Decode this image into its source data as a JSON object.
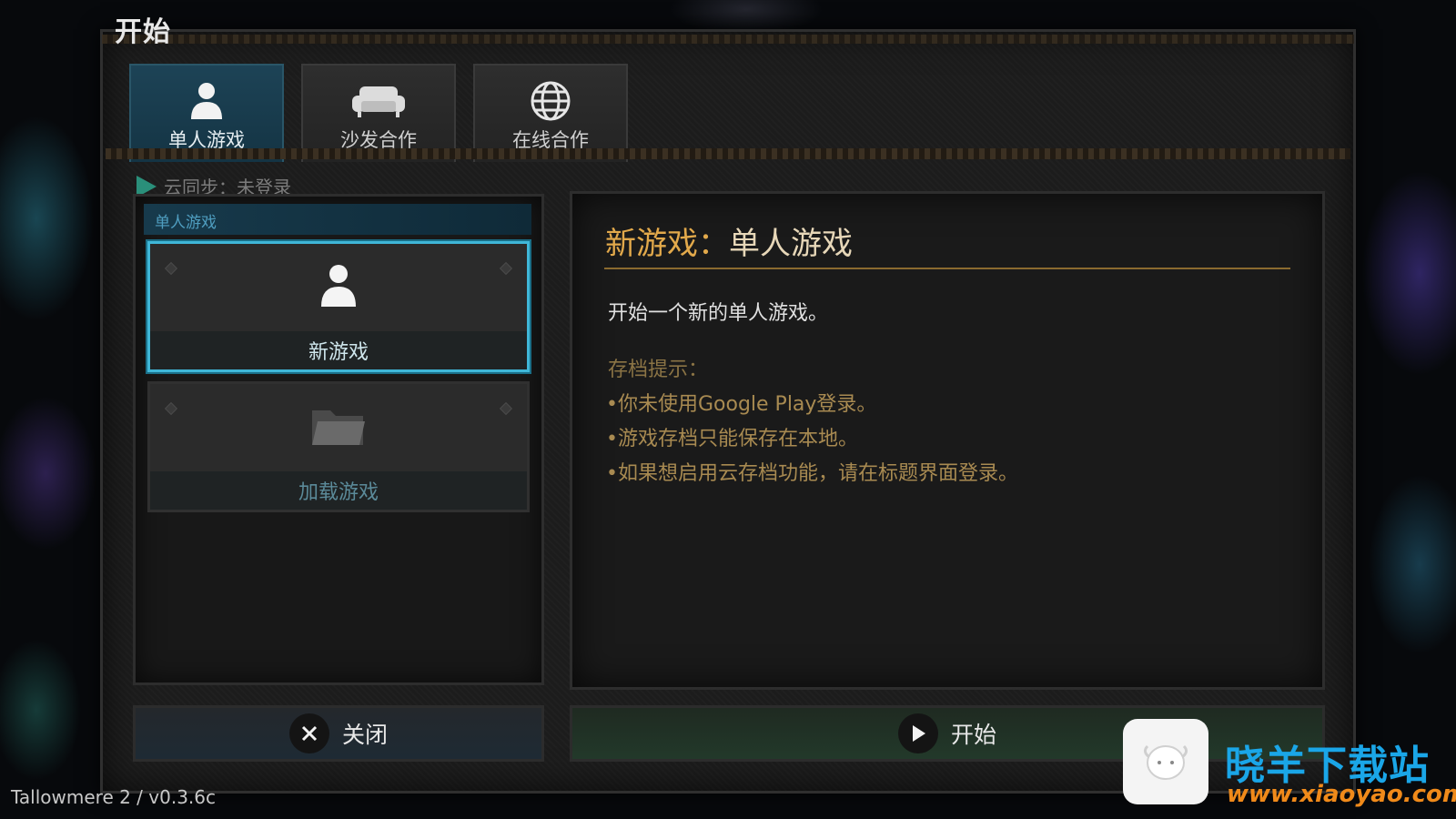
{
  "screen": {
    "title": "开始"
  },
  "tabs": [
    {
      "label": "单人游戏",
      "icon": "person-icon",
      "active": true
    },
    {
      "label": "沙发合作",
      "icon": "sofa-icon",
      "active": false
    },
    {
      "label": "在线合作",
      "icon": "globe-icon",
      "active": false
    }
  ],
  "cloud_sync": {
    "text": "云同步：未登录",
    "icon": "google-play-icon"
  },
  "left_panel": {
    "section_header": "单人游戏",
    "items": [
      {
        "label": "新游戏",
        "icon": "person-icon",
        "selected": true
      },
      {
        "label": "加载游戏",
        "icon": "folder-icon",
        "selected": false
      }
    ]
  },
  "detail": {
    "title_prefix": "新游戏：",
    "title_main": "单人游戏",
    "description": "开始一个新的单人游戏。",
    "hint_title": "存档提示：",
    "hints": [
      "•你未使用Google Play登录。",
      "•游戏存档只能保存在本地。",
      "•如果想启用云存档功能，请在标题界面登录。"
    ]
  },
  "buttons": {
    "close_label": "关闭",
    "start_label": "开始"
  },
  "footer": {
    "version": "Tallowmere 2 / v0.3.6c"
  },
  "watermark": {
    "title": "晓羊下载站",
    "url": "www.xiaoyao.com",
    "logo": "sheep-icon"
  },
  "colors": {
    "accent_gold": "#e2a94b",
    "selected_cyan": "#3fb7d8",
    "hint_gold": "#a88a51",
    "active_tab": "#1d4356"
  }
}
